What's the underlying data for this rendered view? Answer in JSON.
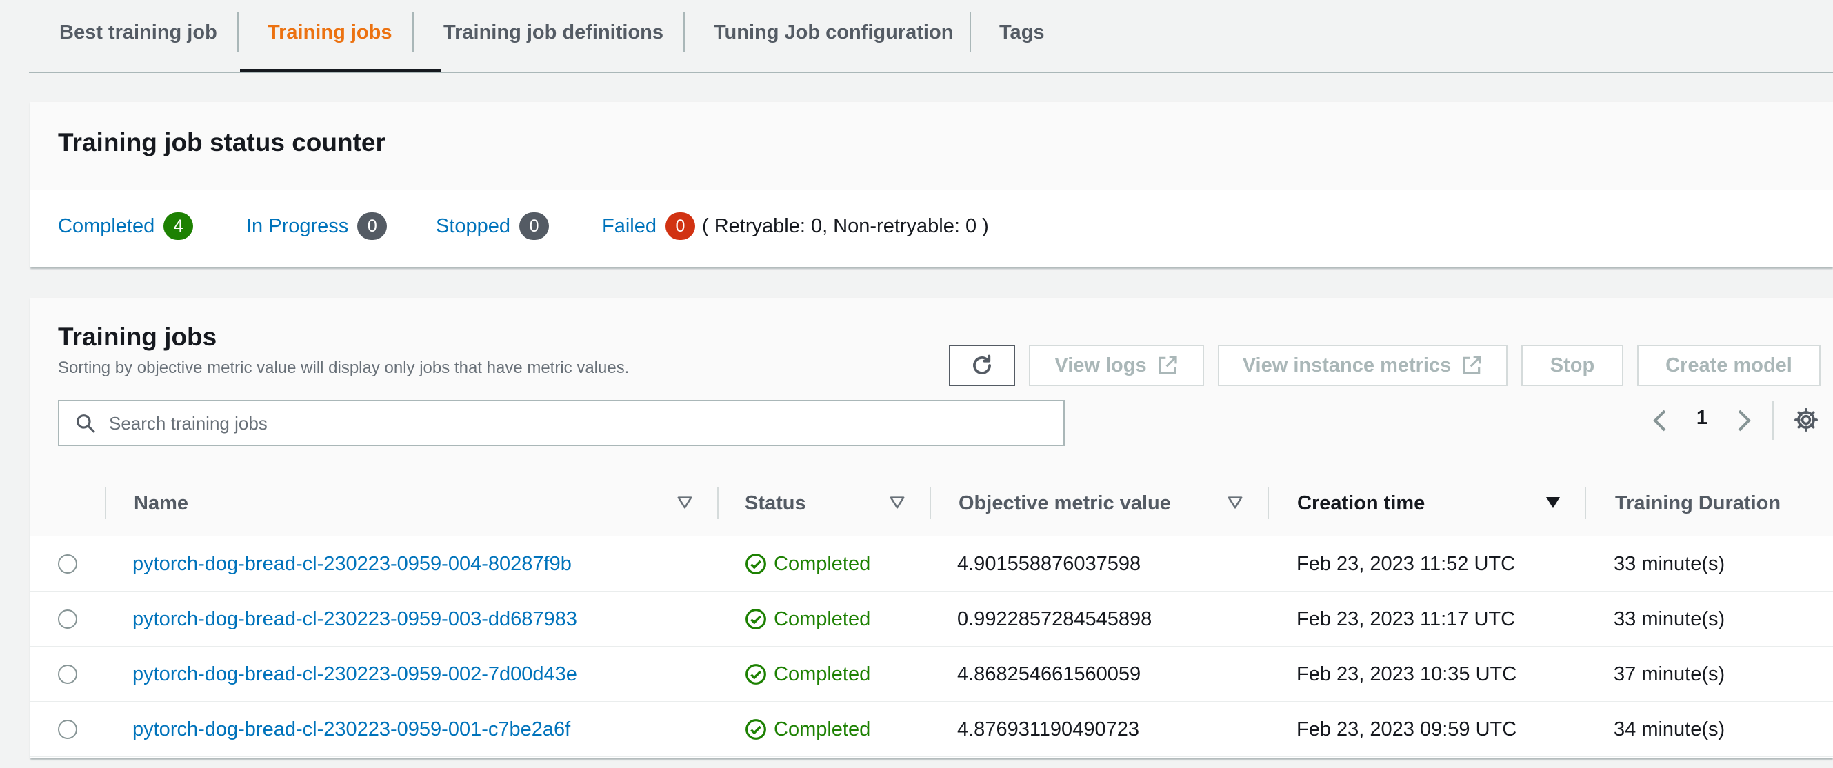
{
  "tabs": [
    "Best training job",
    "Training jobs",
    "Training job definitions",
    "Tuning Job configuration",
    "Tags"
  ],
  "active_tab": "Training jobs",
  "status_counter": {
    "title": "Training job status counter",
    "completed_label": "Completed",
    "completed_count": "4",
    "in_progress_label": "In Progress",
    "in_progress_count": "0",
    "stopped_label": "Stopped",
    "stopped_count": "0",
    "failed_label": "Failed",
    "failed_count": "0",
    "failed_detail": "( Retryable: 0, Non-retryable: 0 )"
  },
  "training_jobs": {
    "title": "Training jobs",
    "description": "Sorting by objective metric value will display only jobs that have metric values.",
    "buttons": {
      "view_logs": "View logs",
      "view_instance_metrics": "View instance metrics",
      "stop": "Stop",
      "create_model": "Create model"
    },
    "search_placeholder": "Search training jobs",
    "page": "1",
    "columns": [
      "Name",
      "Status",
      "Objective metric value",
      "Creation time",
      "Training Duration"
    ],
    "rows": [
      {
        "name": "pytorch-dog-bread-cl-230223-0959-004-80287f9b",
        "status": "Completed",
        "metric": "4.901558876037598",
        "created": "Feb 23, 2023 11:52 UTC",
        "duration": "33 minute(s)"
      },
      {
        "name": "pytorch-dog-bread-cl-230223-0959-003-dd687983",
        "status": "Completed",
        "metric": "0.9922857284545898",
        "created": "Feb 23, 2023 11:17 UTC",
        "duration": "33 minute(s)"
      },
      {
        "name": "pytorch-dog-bread-cl-230223-0959-002-7d00d43e",
        "status": "Completed",
        "metric": "4.868254661560059",
        "created": "Feb 23, 2023 10:35 UTC",
        "duration": "37 minute(s)"
      },
      {
        "name": "pytorch-dog-bread-cl-230223-0959-001-c7be2a6f",
        "status": "Completed",
        "metric": "4.876931190490723",
        "created": "Feb 23, 2023 09:59 UTC",
        "duration": "34 minute(s)"
      }
    ]
  },
  "colors": {
    "accent_orange": "#ec7211",
    "link_blue": "#0073bb",
    "success_green": "#1d8102",
    "error_red": "#d13212",
    "neutral_grey": "#545b64"
  },
  "icons": [
    "refresh-icon",
    "external-link-icon",
    "search-icon",
    "chevron-left-icon",
    "chevron-right-icon",
    "settings-gear-icon",
    "filter-caret-icon",
    "sort-descending-icon",
    "status-check-icon",
    "radio-button"
  ]
}
